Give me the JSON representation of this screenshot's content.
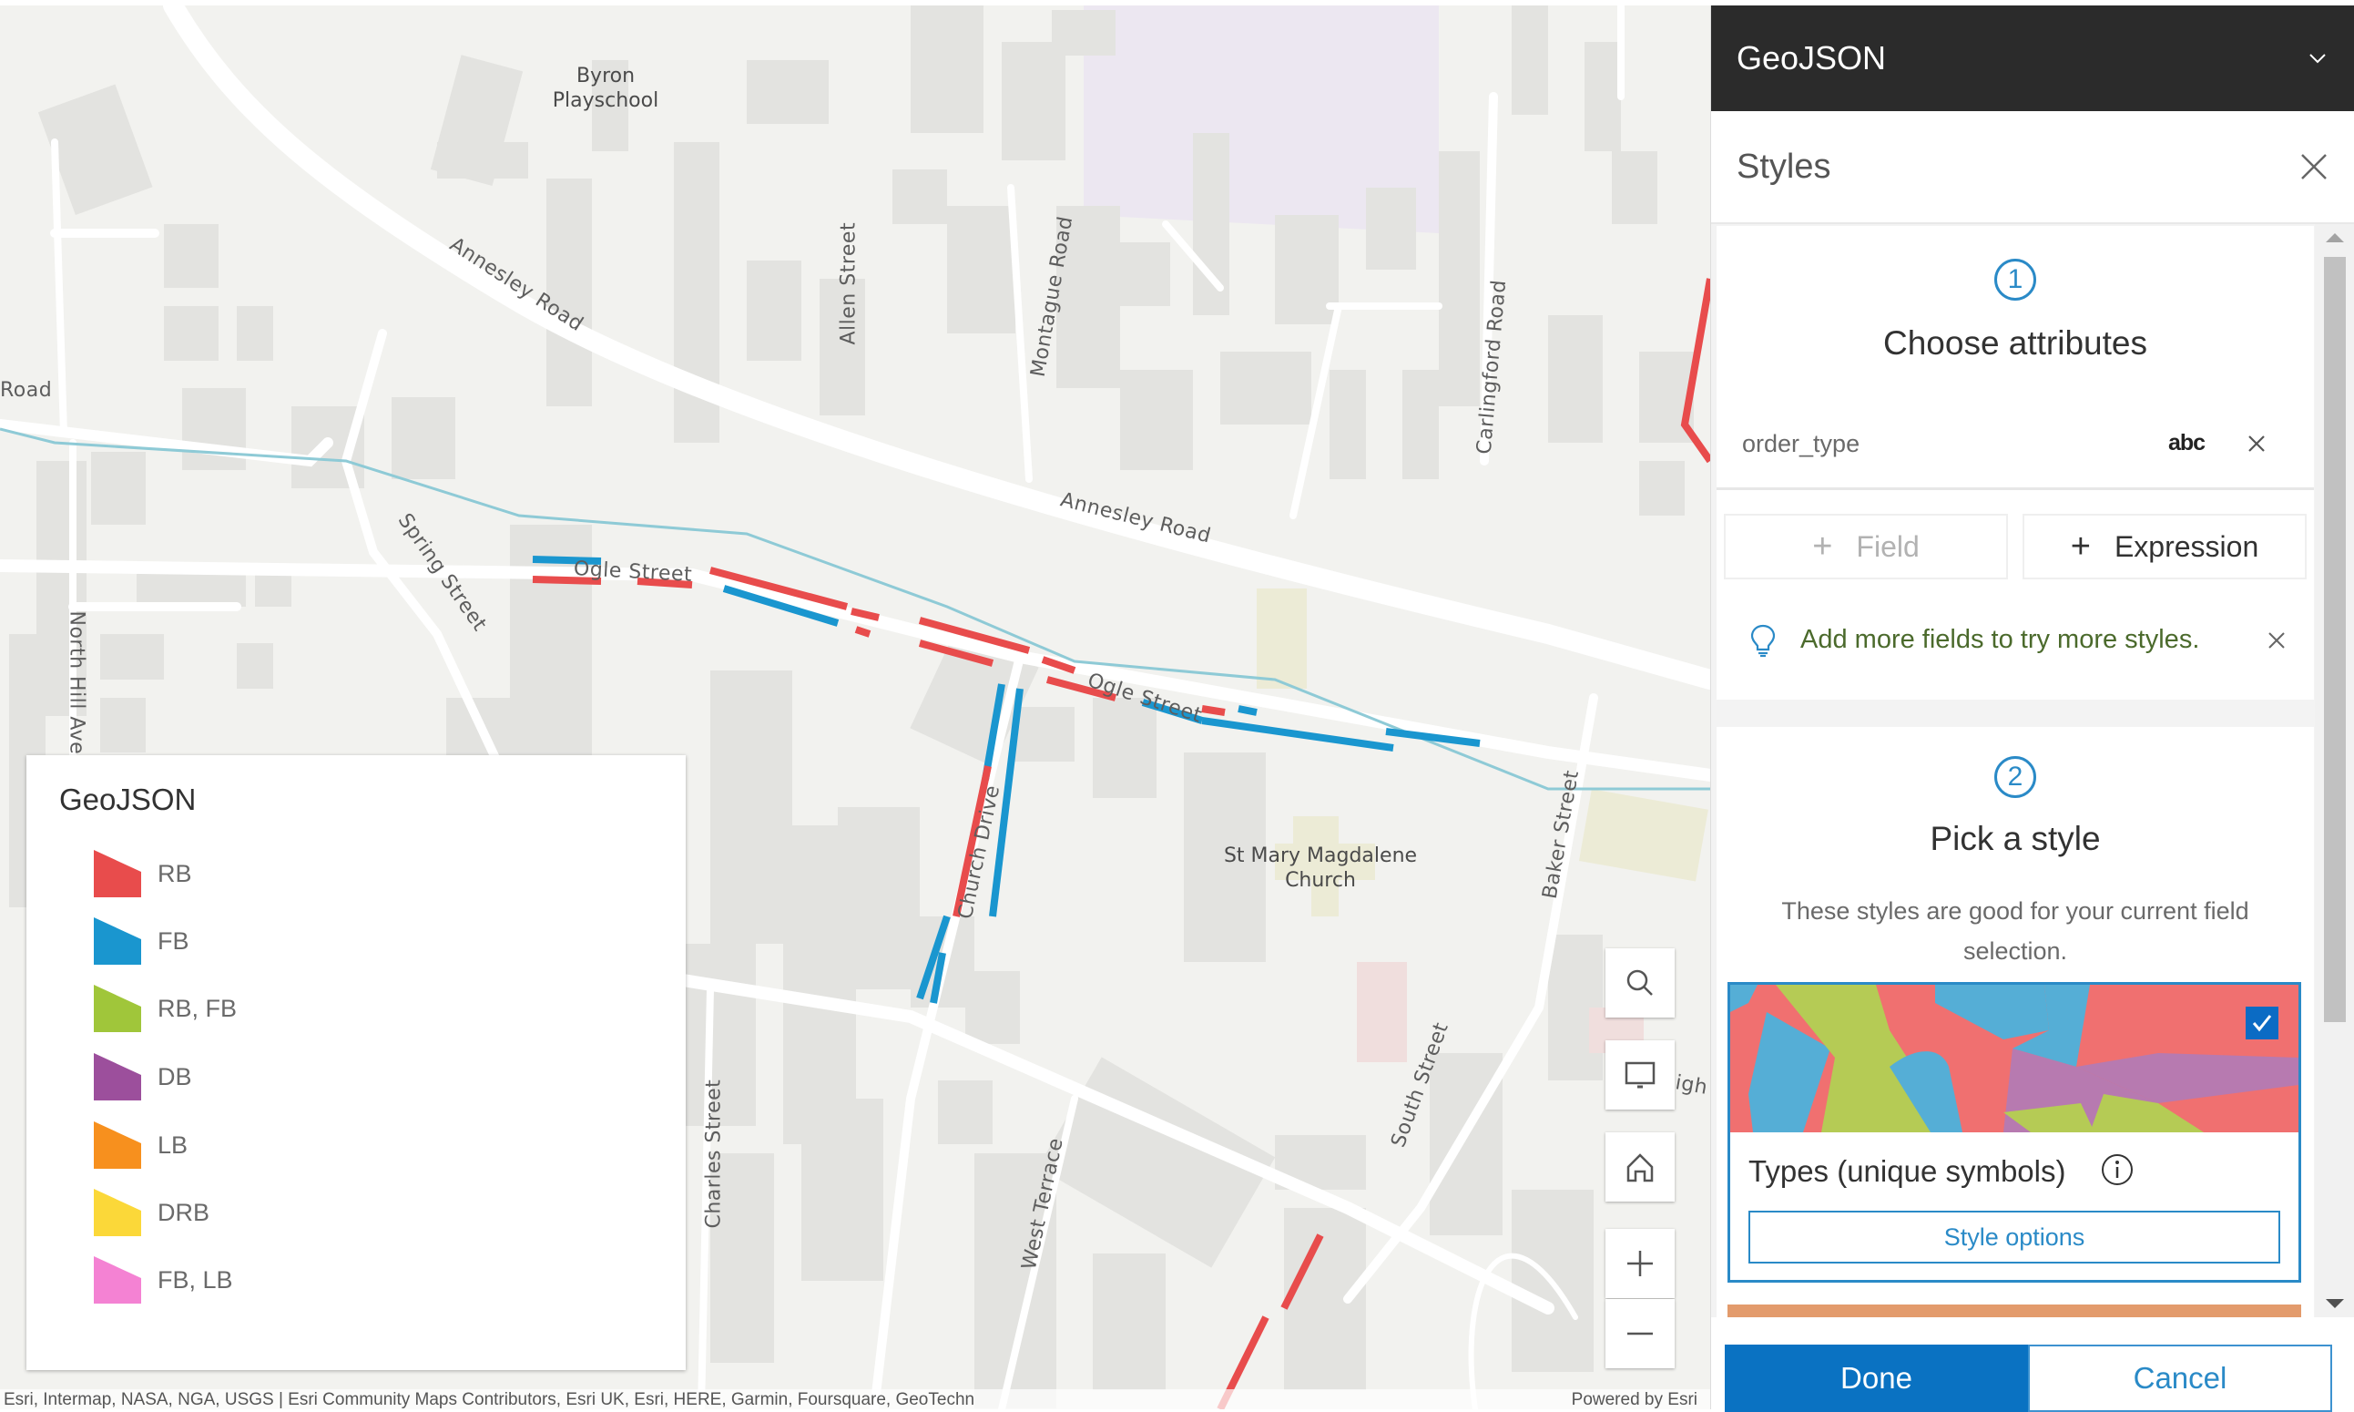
{
  "map": {
    "labels": {
      "byron_playschool_line1": "Byron",
      "byron_playschool_line2": "Playschool",
      "annesley_road_1": "Annesley Road",
      "annesley_road_2": "Annesley Road",
      "allen_street": "Allen Street",
      "montague_road": "Montague Road",
      "carlingford_road": "Carlingford Road",
      "road_left": "Road",
      "spring_street": "Spring Street",
      "north_hill_avenue": "North Hill Aver",
      "ogle_street_1": "Ogle Street",
      "ogle_street_2": "Ogle Street",
      "church_drive": "Church Drive",
      "st_mary_line1": "St Mary Magdalene",
      "st_mary_line2": "Church",
      "baker_street": "Baker Street",
      "south_street": "South Street",
      "charles_street": "Charles Street",
      "west_terrace": "West Terrace",
      "high_partial": "igh"
    },
    "legend": {
      "title": "GeoJSON",
      "items": [
        {
          "label": "RB",
          "color": "#e84c4c"
        },
        {
          "label": "FB",
          "color": "#1a96cf"
        },
        {
          "label": "RB, FB",
          "color": "#a0c63a"
        },
        {
          "label": "DB",
          "color": "#9c4f9c"
        },
        {
          "label": "LB",
          "color": "#f7901e"
        },
        {
          "label": "DRB",
          "color": "#fbd839"
        },
        {
          "label": "FB, LB",
          "color": "#f482d3"
        }
      ]
    },
    "controls": {
      "search": "search-icon",
      "basemap": "monitor-icon",
      "home": "home-icon",
      "zoom_in": "plus-icon",
      "zoom_out": "minus-icon"
    },
    "attribution": "Esri, Intermap, NASA, NGA, USGS | Esri Community Maps Contributors, Esri UK, Esri, HERE, Garmin, Foursquare, GeoTechn",
    "powered_by": "Powered by Esri"
  },
  "panel": {
    "layer_title": "GeoJSON",
    "section_title": "Styles",
    "step1": {
      "number": "1",
      "title": "Choose attributes",
      "field_name": "order_type",
      "field_type": "abc",
      "add_field_label": "Field",
      "add_expression_label": "Expression",
      "tip": "Add more fields to try more styles."
    },
    "step2": {
      "number": "2",
      "title": "Pick a style",
      "description": "These styles are good for your current field selection.",
      "style_card": {
        "title": "Types (unique symbols)",
        "selected": true,
        "options_label": "Style options"
      }
    },
    "buttons": {
      "done": "Done",
      "cancel": "Cancel"
    }
  },
  "colors": {
    "accent": "#0a72c2",
    "header_bg": "#2b2b2b",
    "rb_line": "#e84c4c",
    "fb_line": "#1a96cf"
  }
}
